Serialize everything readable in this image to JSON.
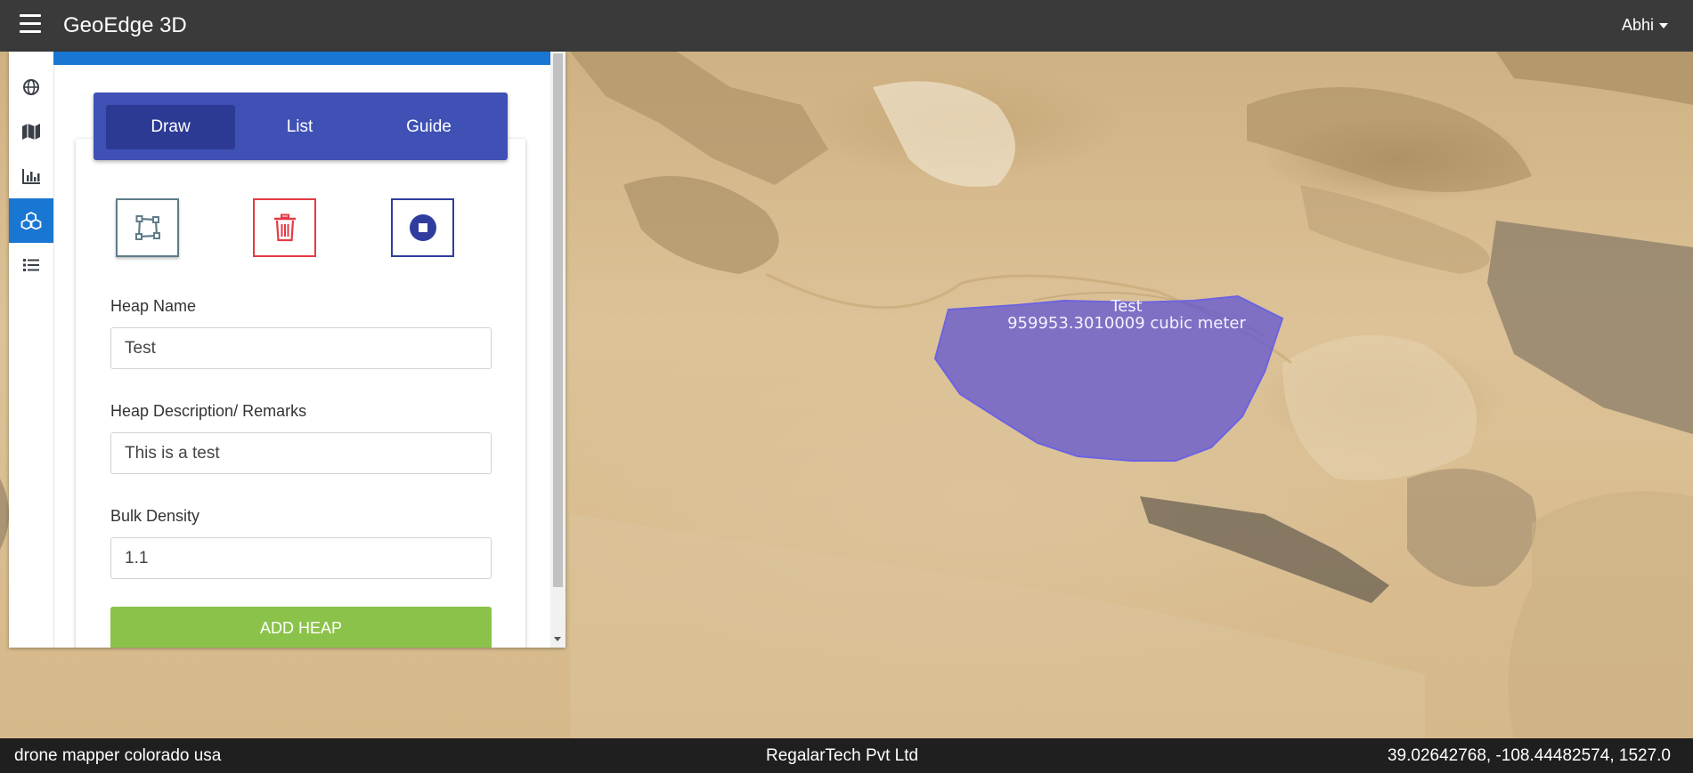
{
  "app": {
    "title": "GeoEdge 3D",
    "user": "Abhi"
  },
  "sidebar": {
    "items": [
      {
        "icon": "globe-icon"
      },
      {
        "icon": "map-icon"
      },
      {
        "icon": "chart-icon"
      },
      {
        "icon": "cubes-icon",
        "active": true
      },
      {
        "icon": "list-icon"
      }
    ]
  },
  "tabs": [
    {
      "label": "Draw",
      "active": true
    },
    {
      "label": "List"
    },
    {
      "label": "Guide"
    }
  ],
  "tools": [
    "edit-polygon-icon",
    "trash-icon",
    "stop-icon"
  ],
  "form": {
    "heap_name_label": "Heap Name",
    "heap_name_value": "Test",
    "description_label": "Heap Description/ Remarks",
    "description_value": "This is a test",
    "density_label": "Bulk Density",
    "density_value": "1.1",
    "add_button": "ADD HEAP"
  },
  "map": {
    "heap_label_name": "Test",
    "heap_label_volume": "959953.3010009 cubic meter",
    "heap_color": "#5b50d6"
  },
  "footer": {
    "left": "drone mapper colorado usa",
    "center": "RegalarTech Pvt Ltd",
    "coords": "39.02642768, -108.44482574, 1527.0"
  },
  "colors": {
    "topbar": "#3a3a3a",
    "primary": "#1976d2",
    "tabbar": "#3f51b5",
    "add_button": "#8bc34a",
    "delete": "#e53945"
  }
}
